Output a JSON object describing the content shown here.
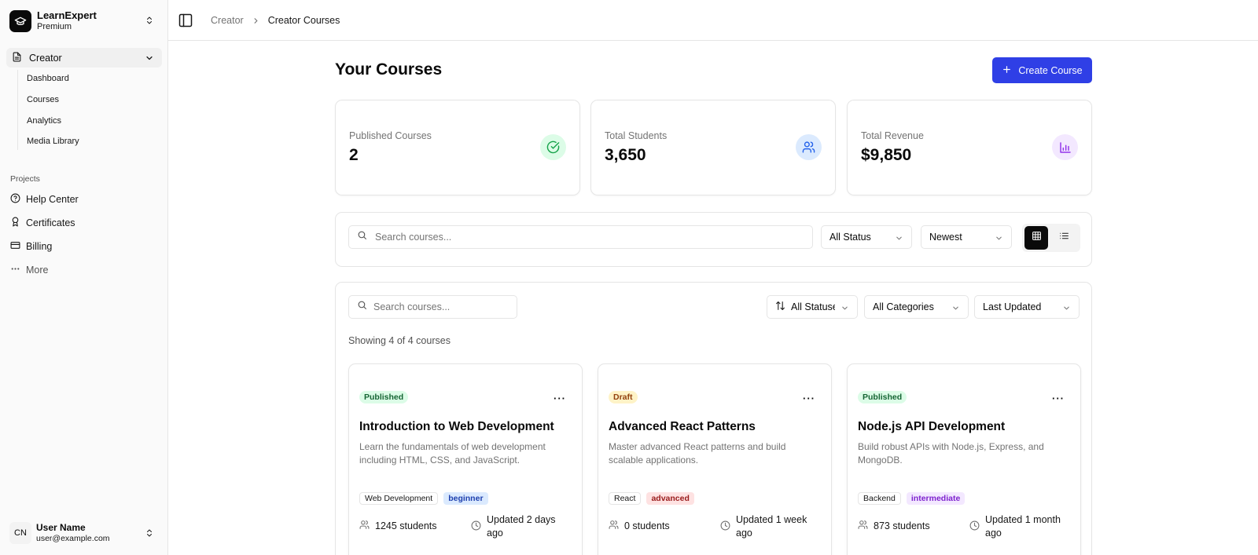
{
  "sidebar": {
    "brand": {
      "name": "LearnExpert",
      "plan": "Premium"
    },
    "creator_label": "Creator",
    "sub_items": [
      "Dashboard",
      "Courses",
      "Analytics",
      "Media Library"
    ],
    "projects_label": "Projects",
    "items": [
      {
        "label": "Help Center",
        "icon": "help-circle-icon"
      },
      {
        "label": "Certificates",
        "icon": "award-icon"
      },
      {
        "label": "Billing",
        "icon": "credit-card-icon"
      },
      {
        "label": "More",
        "icon": "more-horizontal-icon"
      }
    ],
    "user": {
      "initials": "CN",
      "name": "User Name",
      "email": "user@example.com"
    }
  },
  "topbar": {
    "breadcrumb": [
      "Creator",
      "Creator Courses"
    ]
  },
  "main": {
    "title": "Your Courses",
    "create_label": "Create Course",
    "stats": [
      {
        "label": "Published Courses",
        "value": "2",
        "icon": "check-circle-icon",
        "color": "#16a34a",
        "bg": "#dcfce7"
      },
      {
        "label": "Total Students",
        "value": "3,650",
        "icon": "users-icon",
        "color": "#2563eb",
        "bg": "#dbeafe"
      },
      {
        "label": "Total Revenue",
        "value": "$9,850",
        "icon": "bar-chart-icon",
        "color": "#9333ea",
        "bg": "#f3e8ff"
      }
    ],
    "toolbar": {
      "search_placeholder": "Search courses...",
      "status_value": "All Status",
      "sort_value": "Newest"
    },
    "panel": {
      "search_placeholder": "Search courses...",
      "status_value": "All Statuses",
      "category_value": "All Categories",
      "updated_value": "Last Updated",
      "showing": "Showing 4 of 4 courses"
    },
    "courses": [
      {
        "status": "Published",
        "title": "Introduction to Web Development",
        "desc": "Learn the fundamentals of web development including HTML, CSS, and JavaScript.",
        "category": "Web Development",
        "level": "beginner",
        "students": "1245 students",
        "updated": "Updated 2 days ago"
      },
      {
        "status": "Draft",
        "title": "Advanced React Patterns",
        "desc": "Master advanced React patterns and build scalable applications.",
        "category": "React",
        "level": "advanced",
        "students": "0 students",
        "updated": "Updated 1 week ago"
      },
      {
        "status": "Published",
        "title": "Node.js API Development",
        "desc": "Build robust APIs with Node.js, Express, and MongoDB.",
        "category": "Backend",
        "level": "intermediate",
        "students": "873 students",
        "updated": "Updated 1 month ago"
      }
    ]
  }
}
